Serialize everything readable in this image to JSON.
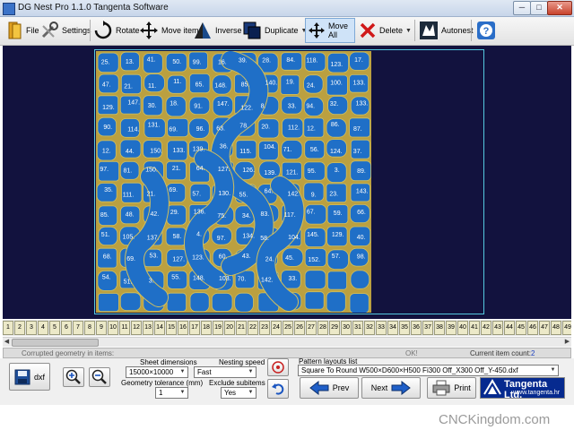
{
  "window": {
    "title": "DG Nest Pro 1.1.0  Tangenta Software",
    "min_label": "─",
    "max_label": "□",
    "close_label": "✕"
  },
  "toolbar": {
    "file": "File",
    "settings": "Settings",
    "rotate": "Rotate",
    "move_item": "Move item",
    "inverse": "Inverse",
    "duplicate": "Duplicate",
    "move_all": "Move All",
    "delete": "Delete",
    "autonest": "Autonest",
    "help_glyph": "?"
  },
  "nest": {
    "labels": [
      "25.",
      "13.",
      "41.",
      "50.",
      "99.",
      "16.",
      "39.",
      "28.",
      "84.",
      "118.",
      "123.",
      "17.",
      "47.",
      "21.",
      "11.",
      "11.",
      "65.",
      "148.",
      "85.",
      "140.",
      "19.",
      "24.",
      "100.",
      "133.",
      "129.",
      "147.",
      "30.",
      "18.",
      "91.",
      "147.",
      "122.",
      "8.",
      "33.",
      "94.",
      "32.",
      "133.",
      "90.",
      "114.",
      "131.",
      "69.",
      "96.",
      "63.",
      "78.",
      "20.",
      "112.",
      "12.",
      "86.",
      "87.",
      "12.",
      "44.",
      "150.",
      "133.",
      "139.",
      "36.",
      "115.",
      "104.",
      "71.",
      "56.",
      "124.",
      "37.",
      "97.",
      "81.",
      "150.",
      "21.",
      "64.",
      "127.",
      "126.",
      "139.",
      "121.",
      "95.",
      "3.",
      "89.",
      "35.",
      "111.",
      "21.",
      "69.",
      "57.",
      "130.",
      "55.",
      "64.",
      "142.",
      "9.",
      "23.",
      "143.",
      "85.",
      "48.",
      "42.",
      "29.",
      "136.",
      "75.",
      "34.",
      "83.",
      "117.",
      "67.",
      "59.",
      "66.",
      "51.",
      "105.",
      "137.",
      "58.",
      "4.",
      "97.",
      "134.",
      "58.",
      "104.",
      "145.",
      "129.",
      "40.",
      "68.",
      "69.",
      "53.",
      "127.",
      "123.",
      "60.",
      "43.",
      "24.",
      "45.",
      "152.",
      "57.",
      "98.",
      "54.",
      "51.",
      "3.",
      "55.",
      "148.",
      "103.",
      "70.",
      "142.",
      "33."
    ]
  },
  "item_tabs": [
    "1",
    "2",
    "3",
    "4",
    "5",
    "6",
    "7",
    "8",
    "9",
    "10",
    "11",
    "12",
    "13",
    "14",
    "15",
    "16",
    "17",
    "18",
    "19",
    "20",
    "21",
    "22",
    "23",
    "24",
    "25",
    "26",
    "27",
    "28",
    "29",
    "30",
    "31",
    "32",
    "33",
    "34",
    "35",
    "36",
    "37",
    "38",
    "39",
    "40",
    "41",
    "42",
    "43",
    "44",
    "45",
    "46",
    "47",
    "48",
    "49"
  ],
  "status": {
    "corrupted": "Corrupted geometry in items:",
    "ok": "OK!",
    "current_count_label": "Current item count:",
    "current_count": "2"
  },
  "controls": {
    "dxf_label": "dxf",
    "sheet_dimensions_label": "Sheet dimensions",
    "sheet_dimensions": "15000×10000",
    "geometry_tolerance_label": "Geometry tolerance (mm)",
    "geometry_tolerance": "1",
    "nesting_speed_label": "Nesting speed",
    "nesting_speed": "Fast",
    "exclude_subitems_label": "Exclude subitems",
    "exclude_subitems": "Yes",
    "pattern_list_label": "Pattern layouts list",
    "pattern_selected": "Square To Round W500×D600×H500 Fi300 Off_X300 Off_Y-450.dxf",
    "prev": "Prev",
    "next": "Next",
    "print": "Print",
    "logo_name": "Tangenta Ltd.",
    "logo_url": "www.tangenta.hr"
  },
  "watermark": "CNCKingdom.com",
  "colors": {
    "canvas_bg": "#12123e",
    "piece_fill": "#1f6fc7",
    "piece_outline": "#cfbf60",
    "sheet_border": "#55c8e0",
    "logo_bg": "#062a8f"
  }
}
